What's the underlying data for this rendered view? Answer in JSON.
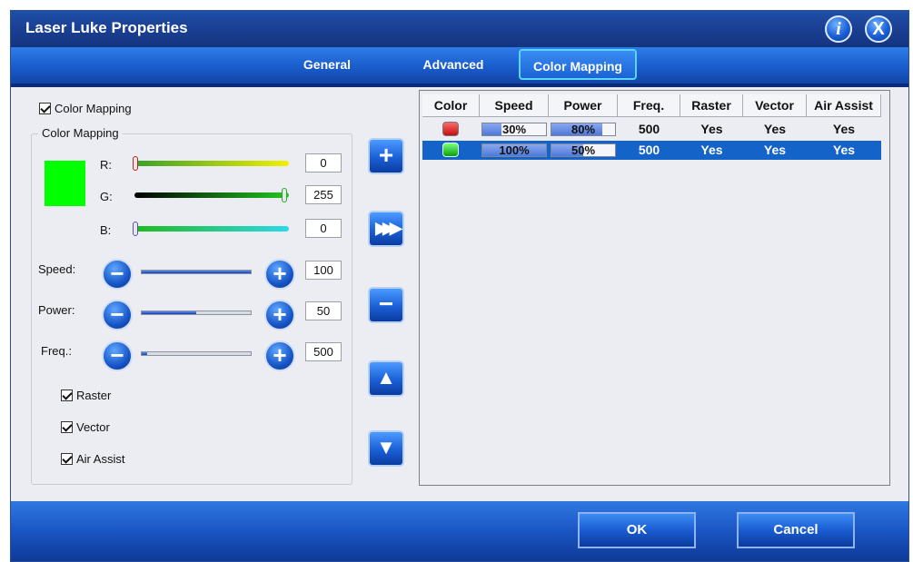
{
  "window": {
    "title": "Laser Luke Properties"
  },
  "titlebar_buttons": {
    "info_glyph": "i",
    "close_glyph": "X"
  },
  "tabs": [
    {
      "label": "General"
    },
    {
      "label": "Advanced"
    },
    {
      "label": "Color Mapping",
      "active": true
    }
  ],
  "color_mapping": {
    "enable_label": "Color Mapping",
    "enabled": true,
    "group_label": "Color Mapping",
    "swatch_color": "#00ff00",
    "r": {
      "label": "R:",
      "value": "0"
    },
    "g": {
      "label": "G:",
      "value": "255"
    },
    "b": {
      "label": "B:",
      "value": "0"
    },
    "speed": {
      "label": "Speed:",
      "value": "100",
      "level": 1.0
    },
    "power": {
      "label": "Power:",
      "value": "50",
      "level": 0.5
    },
    "freq": {
      "label": "Freq.:",
      "value": "500",
      "level": 0.05
    },
    "raster": {
      "label": "Raster",
      "checked": true
    },
    "vector": {
      "label": "Vector",
      "checked": true
    },
    "air_assist": {
      "label": "Air Assist",
      "checked": true
    }
  },
  "side_buttons": {
    "add_icon": "add-icon",
    "apply_icon": "fast-forward-icon",
    "remove_icon": "remove-icon",
    "up_icon": "arrow-up-icon",
    "down_icon": "arrow-down-icon"
  },
  "table": {
    "columns": [
      "Color",
      "Speed",
      "Power",
      "Freq.",
      "Raster",
      "Vector",
      "Air Assist"
    ],
    "rows": [
      {
        "color": "#e02020",
        "speed": "30%",
        "speed_level": 0.3,
        "power": "80%",
        "power_level": 0.8,
        "freq": "500",
        "raster": "Yes",
        "vector": "Yes",
        "air_assist": "Yes",
        "selected": false
      },
      {
        "color": "#00c000",
        "speed": "100%",
        "speed_level": 1.0,
        "power": "50%",
        "power_level": 0.5,
        "freq": "500",
        "raster": "Yes",
        "vector": "Yes",
        "air_assist": "Yes",
        "selected": true
      }
    ]
  },
  "dialog": {
    "ok": "OK",
    "cancel": "Cancel"
  }
}
